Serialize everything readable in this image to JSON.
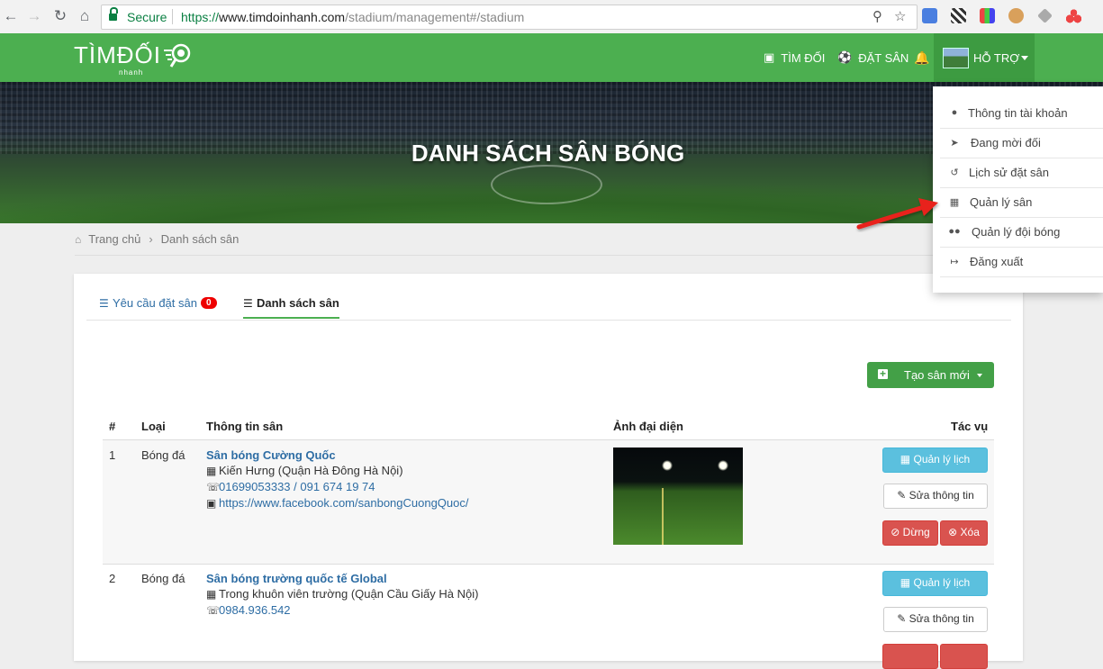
{
  "browser": {
    "secure_label": "Secure",
    "url_scheme": "https://",
    "url_host": "www.timdoinhanh.com",
    "url_path": "/stadium/management#/stadium",
    "icons": [
      "back-icon",
      "forward-icon",
      "reload-icon",
      "home-icon",
      "zoom-icon",
      "star-icon"
    ]
  },
  "site": {
    "logo_main": "TÌMĐỐI",
    "logo_sub": "nhanh",
    "nav": {
      "find_team": "TÌM ĐỐI",
      "book_field": "ĐẶT SÂN",
      "support": "HỖ TRỢ"
    },
    "colors": {
      "header": "#4caf50",
      "accent": "#43a047",
      "link": "#2e6da4",
      "danger": "#d9534f",
      "info": "#5bc0de"
    }
  },
  "hero": {
    "title": "DANH SÁCH SÂN BÓNG"
  },
  "breadcrumb": {
    "home": "Trang chủ",
    "current": "Danh sách sân"
  },
  "tabs": {
    "requests": "Yêu cầu đặt sân",
    "requests_count": "0",
    "list": "Danh sách sân"
  },
  "create_button": "Tạo sân mới",
  "table": {
    "headers": {
      "num": "#",
      "type": "Loại",
      "info": "Thông tin sân",
      "photo": "Ảnh đại diện",
      "actions": "Tác vụ"
    },
    "rows": [
      {
        "num": "1",
        "type": "Bóng đá",
        "name": "Sân bóng Cường Quốc",
        "address": "Kiến Hưng (Quận Hà Đông Hà Nội)",
        "phone": "01699053333 / 091 674 19 74",
        "facebook": "https://www.facebook.com/sanbongCuongQuoc/"
      },
      {
        "num": "2",
        "type": "Bóng đá",
        "name": "Sân bóng trường quốc tế Global",
        "address": "Trong khuôn viên trường (Quận Cầu Giấy Hà Nội)",
        "phone": "0984.936.542"
      }
    ],
    "actions": {
      "calendar": "Quản lý lịch",
      "edit": "Sửa thông tin",
      "stop": "Dừng",
      "delete": "Xóa"
    }
  },
  "dropdown": {
    "items": [
      {
        "label": "Thông tin tài khoản",
        "icon": "user-icon"
      },
      {
        "label": "Đang mời đối",
        "icon": "send-icon"
      },
      {
        "label": "Lịch sử đặt sân",
        "icon": "history-icon"
      },
      {
        "label": "Quản lý sân",
        "icon": "grid-icon"
      },
      {
        "label": "Quản lý đội bóng",
        "icon": "users-icon"
      },
      {
        "label": "Đăng xuất",
        "icon": "logout-icon"
      }
    ]
  }
}
